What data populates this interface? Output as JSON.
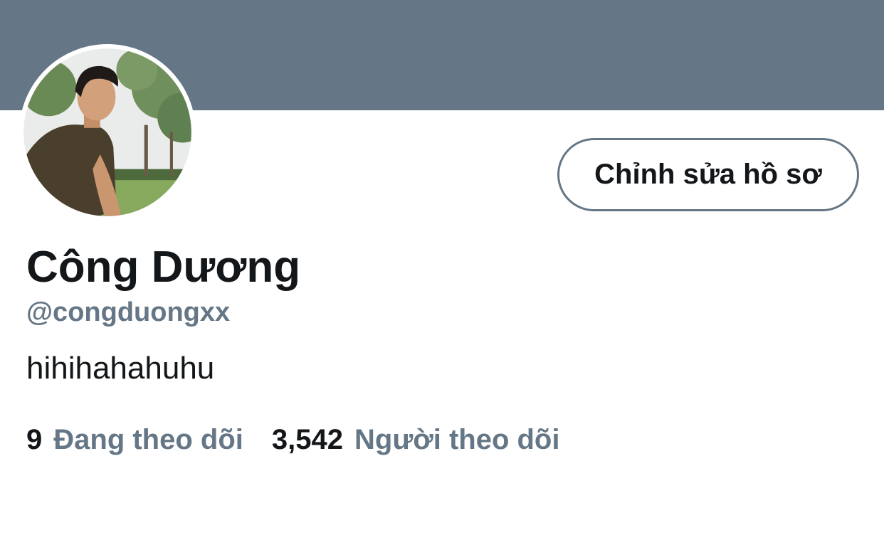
{
  "profile": {
    "display_name": "Công Dương",
    "handle": "@congduongxx",
    "bio": "hihihahahuhu",
    "edit_button_label": "Chỉnh sửa hồ sơ"
  },
  "stats": {
    "following_count": "9",
    "following_label": "Đang theo dõi",
    "followers_count": "3,542",
    "followers_label": "Người theo dõi"
  },
  "colors": {
    "banner": "#657786",
    "text_primary": "#14171a",
    "text_secondary": "#657786"
  }
}
